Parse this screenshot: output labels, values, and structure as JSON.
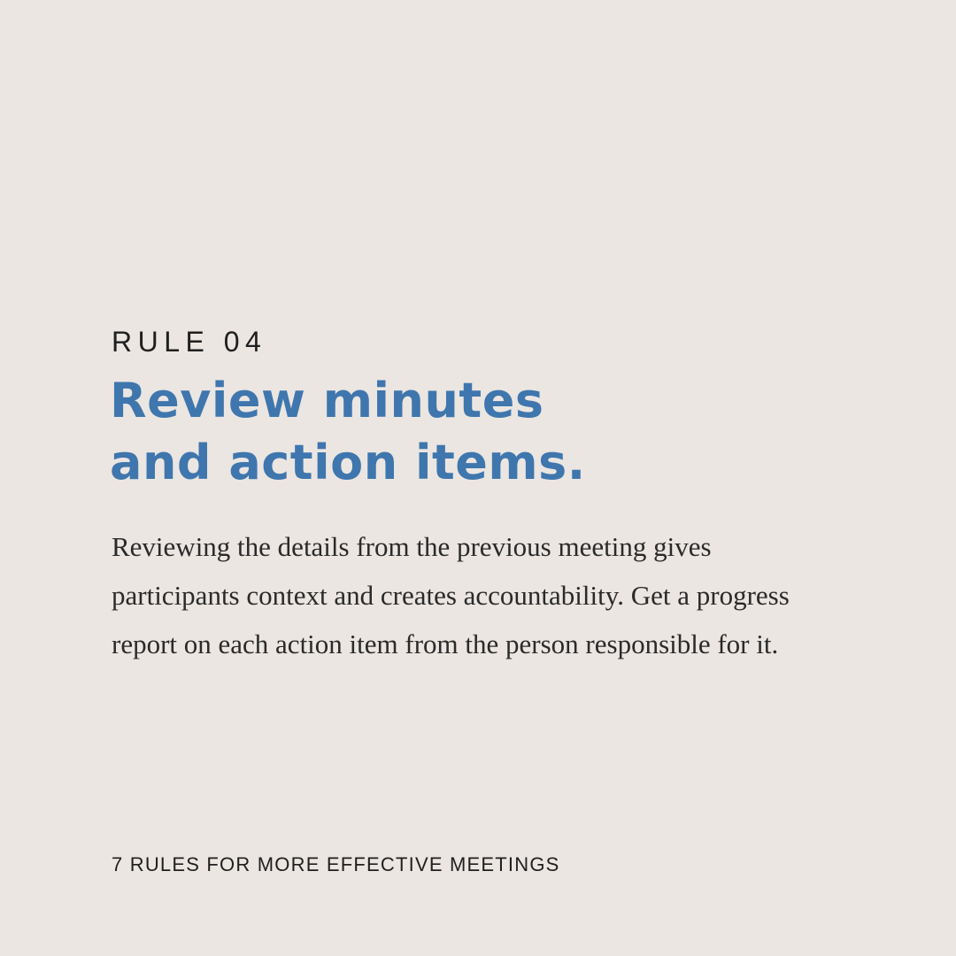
{
  "rule": {
    "label": "RULE 04"
  },
  "headline": {
    "line1": "Review minutes",
    "line2": "and action items."
  },
  "body": {
    "text": "Reviewing the details from the previous meeting gives participants context and creates accountability. Get a progress report on each action item from the person responsible for it."
  },
  "footer": {
    "text": "7 RULES FOR MORE EFFECTIVE MEETINGS"
  },
  "colors": {
    "background": "#ebe6e2",
    "headline": "#3f76ad",
    "text": "#1f1f1f"
  }
}
